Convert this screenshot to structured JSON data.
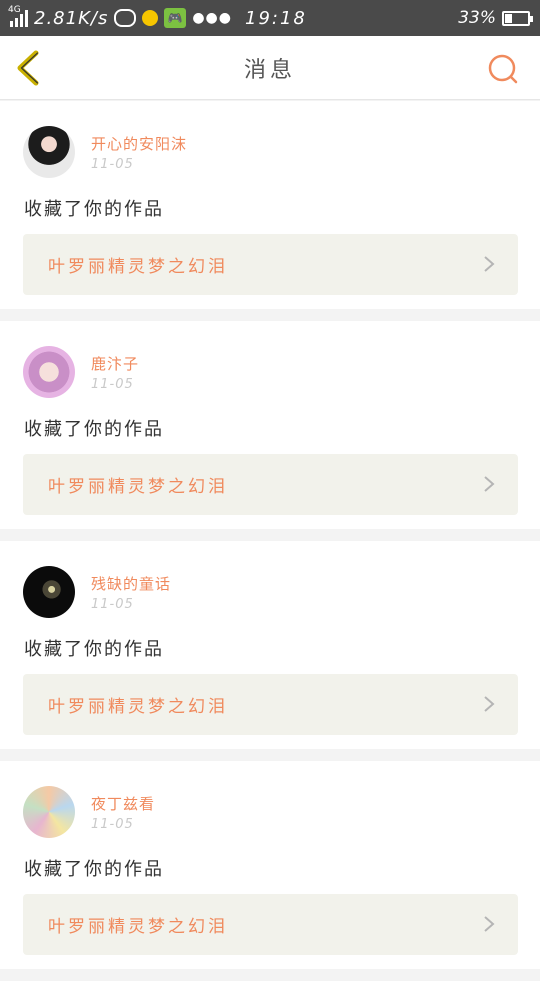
{
  "status_bar": {
    "network": "4G",
    "speed": "2.81K/s",
    "time": "19:18",
    "battery": "33%",
    "battery_level": 0.33
  },
  "nav": {
    "title": "消息"
  },
  "messages": [
    {
      "username": "开心的安阳沫",
      "date": "11-05",
      "action": "收藏了你的作品",
      "work_title": "叶罗丽精灵梦之幻泪"
    },
    {
      "username": "鹿汴子",
      "date": "11-05",
      "action": "收藏了你的作品",
      "work_title": "叶罗丽精灵梦之幻泪"
    },
    {
      "username": "残缺的童话",
      "date": "11-05",
      "action": "收藏了你的作品",
      "work_title": "叶罗丽精灵梦之幻泪"
    },
    {
      "username": "夜丁兹看",
      "date": "11-05",
      "action": "收藏了你的作品",
      "work_title": "叶罗丽精灵梦之幻泪"
    }
  ],
  "colors": {
    "accent": "#f08a5d",
    "back_arrow": "#c9b000",
    "status_bg": "#4a4a4a",
    "card_link_bg": "#f2f2eb"
  }
}
